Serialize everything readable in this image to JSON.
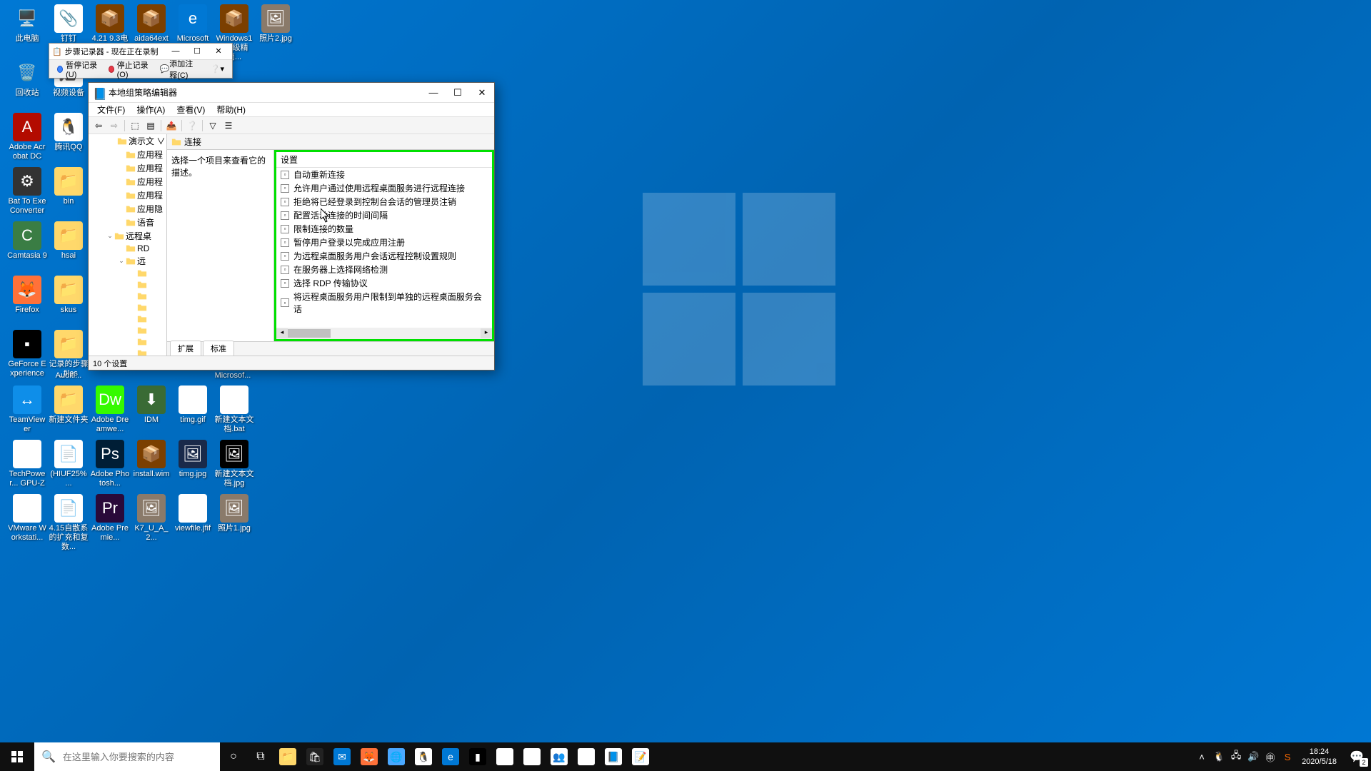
{
  "desktop_icons": [
    {
      "row": 0,
      "col": 0,
      "label": "此电脑",
      "bg": "transparent",
      "glyph": "🖥️"
    },
    {
      "row": 0,
      "col": 1,
      "label": "钉钉",
      "bg": "#fff",
      "glyph": "📎"
    },
    {
      "row": 0,
      "col": 2,
      "label": "4.21 9.3电场",
      "bg": "#7b3f00",
      "glyph": "📦"
    },
    {
      "row": 0,
      "col": 3,
      "label": "aida64extr...",
      "bg": "#7b3f00",
      "glyph": "📦"
    },
    {
      "row": 0,
      "col": 4,
      "label": "Microsoft",
      "bg": "#0078d4",
      "glyph": "e"
    },
    {
      "row": 0,
      "col": 5,
      "label": "Windows10超级精简...",
      "bg": "#7b3f00",
      "glyph": "📦"
    },
    {
      "row": 0,
      "col": 6,
      "label": "照片2.jpg",
      "bg": "#8a7a6a",
      "glyph": "🖼"
    },
    {
      "row": 1,
      "col": 0,
      "label": "回收站",
      "bg": "transparent",
      "glyph": "🗑️"
    },
    {
      "row": 1,
      "col": 1,
      "label": "视频设备",
      "bg": "#fff",
      "glyph": "🎥"
    },
    {
      "row": 2,
      "col": 0,
      "label": "Adobe Acrobat DC",
      "bg": "#b30b00",
      "glyph": "A"
    },
    {
      "row": 2,
      "col": 1,
      "label": "腾讯QQ",
      "bg": "#fff",
      "glyph": "🐧"
    },
    {
      "row": 3,
      "col": 0,
      "label": "Bat To Exe Converter",
      "bg": "#333",
      "glyph": "⚙"
    },
    {
      "row": 3,
      "col": 1,
      "label": "bin",
      "bg": "#ffd86b",
      "glyph": "📁"
    },
    {
      "row": 4,
      "col": 0,
      "label": "Camtasia 9",
      "bg": "#3a7d44",
      "glyph": "C"
    },
    {
      "row": 4,
      "col": 1,
      "label": "hsai",
      "bg": "#ffd86b",
      "glyph": "📁"
    },
    {
      "row": 5,
      "col": 0,
      "label": "Firefox",
      "bg": "#ff7139",
      "glyph": "🦊"
    },
    {
      "row": 5,
      "col": 1,
      "label": "skus",
      "bg": "#ffd86b",
      "glyph": "📁"
    },
    {
      "row": 6,
      "col": 0,
      "label": "GeForce Experience",
      "bg": "#000",
      "glyph": "▪"
    },
    {
      "row": 6,
      "col": 1,
      "label": "记录的步骤_files",
      "bg": "#ffd86b",
      "glyph": "📁"
    },
    {
      "row": 7,
      "col": 0,
      "label": "TeamViewer",
      "bg": "#0e8ee9",
      "glyph": "↔"
    },
    {
      "row": 7,
      "col": 1,
      "label": "新建文件夹",
      "bg": "#ffd86b",
      "glyph": "📁"
    },
    {
      "row": 7,
      "col": 2,
      "label": "Adobe Dreamwe...",
      "bg": "#35fa00",
      "glyph": "Dw"
    },
    {
      "row": 7,
      "col": 3,
      "label": "IDM",
      "bg": "#3a6b35",
      "glyph": "⬇"
    },
    {
      "row": 7,
      "col": 4,
      "label": "timg.gif",
      "bg": "#fff",
      "glyph": "🖼"
    },
    {
      "row": 7,
      "col": 5,
      "label": "新建文本文档.bat",
      "bg": "#fff",
      "glyph": "⚙"
    },
    {
      "row": 8,
      "col": 0,
      "label": "TechPower... GPU-Z",
      "bg": "#fff",
      "glyph": "G"
    },
    {
      "row": 8,
      "col": 1,
      "label": "(HIUF25% ...",
      "bg": "#fff",
      "glyph": "📄"
    },
    {
      "row": 8,
      "col": 2,
      "label": "Adobe Photosh...",
      "bg": "#001e36",
      "glyph": "Ps"
    },
    {
      "row": 8,
      "col": 3,
      "label": "install.wim",
      "bg": "#7b3f00",
      "glyph": "📦"
    },
    {
      "row": 8,
      "col": 4,
      "label": "timg.jpg",
      "bg": "#1a2a4a",
      "glyph": "🖼"
    },
    {
      "row": 8,
      "col": 5,
      "label": "新建文本文档.jpg",
      "bg": "#000",
      "glyph": "🖼"
    },
    {
      "row": 9,
      "col": 0,
      "label": "VMware Workstati...",
      "bg": "#fff",
      "glyph": "▣"
    },
    {
      "row": 9,
      "col": 1,
      "label": "4.15自散系的扩充和复数...",
      "bg": "#fff",
      "glyph": "📄"
    },
    {
      "row": 9,
      "col": 2,
      "label": "Adobe Premie...",
      "bg": "#2a0a3a",
      "glyph": "Pr"
    },
    {
      "row": 9,
      "col": 3,
      "label": "K7_U_A_2...",
      "bg": "#8a7a6a",
      "glyph": "🖼"
    },
    {
      "row": 9,
      "col": 4,
      "label": "viewfile.jfif",
      "bg": "#fff",
      "glyph": "🖼"
    },
    {
      "row": 9,
      "col": 5,
      "label": "照片1.jpg",
      "bg": "#8a7a6a",
      "glyph": "🖼"
    }
  ],
  "psr": {
    "title": "步骤记录器 - 现在正在录制",
    "pause": "暂停记录(U)",
    "stop": "停止记录(O)",
    "comment": "添加注释(C)"
  },
  "gpedit": {
    "title": "本地组策略编辑器",
    "menu": {
      "file": "文件(F)",
      "action": "操作(A)",
      "view": "查看(V)",
      "help": "帮助(H)"
    },
    "tree": [
      {
        "indent": 40,
        "exp": "",
        "label": "演示文 ∨"
      },
      {
        "indent": 40,
        "exp": "",
        "label": "应用程"
      },
      {
        "indent": 40,
        "exp": "",
        "label": "应用程"
      },
      {
        "indent": 40,
        "exp": "",
        "label": "应用程"
      },
      {
        "indent": 40,
        "exp": "",
        "label": "应用程"
      },
      {
        "indent": 40,
        "exp": "",
        "label": "应用隐"
      },
      {
        "indent": 40,
        "exp": "",
        "label": "语音"
      },
      {
        "indent": 24,
        "exp": "⌄",
        "label": "远程桌"
      },
      {
        "indent": 40,
        "exp": "",
        "label": "RD"
      },
      {
        "indent": 40,
        "exp": "⌄",
        "label": "远"
      },
      {
        "indent": 56,
        "exp": "",
        "label": ""
      },
      {
        "indent": 56,
        "exp": "",
        "label": ""
      },
      {
        "indent": 56,
        "exp": "",
        "label": ""
      },
      {
        "indent": 56,
        "exp": "",
        "label": ""
      },
      {
        "indent": 56,
        "exp": "",
        "label": ""
      },
      {
        "indent": 56,
        "exp": "",
        "label": ""
      },
      {
        "indent": 56,
        "exp": "",
        "label": ""
      },
      {
        "indent": 56,
        "exp": "",
        "label": ""
      },
      {
        "indent": 56,
        "exp": "",
        "label": ""
      }
    ],
    "content_header": "连接",
    "desc_text": "选择一个项目来查看它的描述。",
    "settings_header": "设置",
    "settings": [
      "自动重新连接",
      "允许用户通过使用远程桌面服务进行远程连接",
      "拒绝将已经登录到控制台会话的管理员注销",
      "配置活动连接的时间间隔",
      "限制连接的数量",
      "暂停用户登录以完成应用注册",
      "为远程桌面服务用户会话远程控制设置规则",
      "在服务器上选择网络检测",
      "选择 RDP 传输协议",
      "将远程桌面服务用户限制到单独的远程桌面服务会话"
    ],
    "tabs": {
      "ext": "扩展",
      "std": "标准"
    },
    "status": "10 个设置"
  },
  "hidden_desktop_labels": {
    "auditi": "Auditi...",
    "microsof": "Microsof..."
  },
  "taskbar": {
    "search_placeholder": "在这里输入你要搜索的内容",
    "clock_time": "18:24",
    "clock_date": "2020/5/18",
    "notif_count": "2"
  }
}
